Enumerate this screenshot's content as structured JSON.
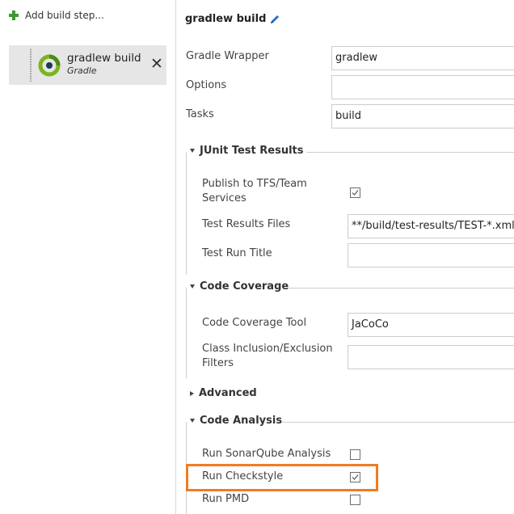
{
  "left_panel": {
    "add_step_label": "Add build step...",
    "step": {
      "name": "gradlew build",
      "type": "Gradle"
    }
  },
  "task": {
    "title": "gradlew build",
    "fields": {
      "gradle_wrapper": {
        "label": "Gradle Wrapper",
        "value": "gradlew"
      },
      "options": {
        "label": "Options",
        "value": ""
      },
      "tasks": {
        "label": "Tasks",
        "value": "build"
      }
    },
    "junit": {
      "title": "JUnit Test Results",
      "publish_label_line1": "Publish to TFS/Team",
      "publish_label_line2": "Services",
      "publish_checked": true,
      "results_files_label": "Test Results Files",
      "results_files_value": "**/build/test-results/TEST-*.xml",
      "run_title_label": "Test Run Title",
      "run_title_value": ""
    },
    "coverage": {
      "title": "Code Coverage",
      "tool_label": "Code Coverage Tool",
      "tool_value": "JaCoCo",
      "filters_label_line1": "Class Inclusion/Exclusion",
      "filters_label_line2": "Filters",
      "filters_value": ""
    },
    "advanced": {
      "title": "Advanced"
    },
    "analysis": {
      "title": "Code Analysis",
      "sonarqube_label": "Run SonarQube Analysis",
      "sonarqube_checked": false,
      "checkstyle_label": "Run Checkstyle",
      "checkstyle_checked": true,
      "pmd_label": "Run PMD",
      "pmd_checked": false
    }
  },
  "colors": {
    "accent_green": "#3c9a2f",
    "gradle_green": "#7ab51d",
    "highlight_orange": "#f07c22",
    "pencil_blue": "#1f6fc5"
  },
  "icons": [
    "plus-icon",
    "gradle-icon",
    "close-icon",
    "pencil-icon",
    "checkbox-check-icon",
    "expand-triangle-icon",
    "collapse-triangle-icon"
  ]
}
